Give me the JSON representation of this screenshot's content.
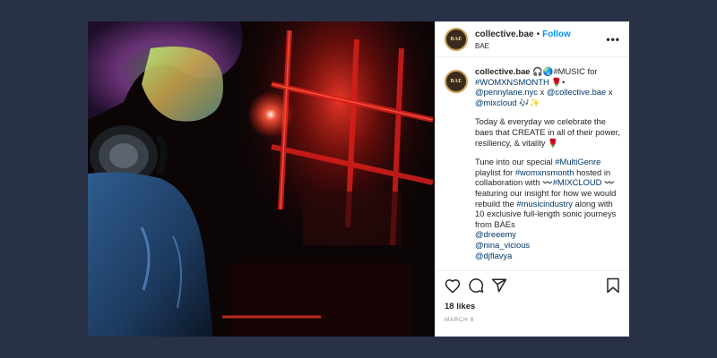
{
  "post": {
    "image_alt": "DJ with headphones under red lights",
    "header": {
      "avatar_text": "BAE",
      "username": "collective.bae",
      "dot": "•",
      "follow_label": "Follow",
      "subtitle": "BAE",
      "more_label": "•••"
    },
    "caption": {
      "avatar_text": "BAE",
      "username": "collective.bae",
      "line1_rest": " 🎧🌏#MUSIC for",
      "hashtag_womxnsmonth": "#WOMXNSMONTH",
      "rose": " 🌹•",
      "mention_pennylane": "@pennylane.nyc",
      "x1": " x ",
      "mention_collective": "@collective.bae",
      "x2": " x",
      "mention_mixcloud": "@mixcloud",
      "music_notes": " 🎶✨",
      "para1": "Today & everyday we celebrate the baes that CREATE in all of their power, resiliency, & vitality 🌹",
      "para2_a": "Tune into our special ",
      "hashtag_multigenre": "#MultiGenre",
      "para2_b": " playlist for ",
      "hashtag_womxnsmonth_lower": "#womxnsmonth",
      "para2_c": " hosted in collaboration with 〰️",
      "hashtag_mixcloud": "#MIXCLOUD",
      "para2_d": " 〰️ featuring our insight for how we would rebuild the ",
      "hashtag_musicindustry": "#musicindustry",
      "para2_e": " along with 10 exclusive full-length sonic journeys from BAEs",
      "mention_dreeemy": "@dreeemy",
      "mention_nina": "@nina_vicious",
      "mention_djflavya": "@djflavya"
    },
    "actions": {
      "likes": "18 likes",
      "date": "MARCH 8"
    }
  },
  "colors": {
    "background": "#283146",
    "follow": "#0095f6",
    "link": "#00376b"
  }
}
